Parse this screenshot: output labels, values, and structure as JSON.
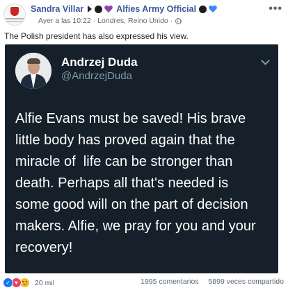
{
  "post": {
    "author": "Sandra Villar",
    "group": "Alfies Army Official",
    "timestamp": "Ayer a las 10:22",
    "location": "Londres, Reino Unido",
    "separator": "·",
    "text": "The Polish president has also expressed his view.",
    "more_menu": "•••"
  },
  "tweet": {
    "display_name": "Andrzej Duda",
    "handle": "@AndrzejDuda",
    "lines": [
      "Alfie Evans must be saved! His brave",
      "little body has proved again that the",
      "miracle of  life can be stronger than",
      "death. Perhaps all that's needed is",
      "some good will on the part of decision",
      "makers. Alfie, we pray for you and your",
      "recovery!"
    ]
  },
  "footer": {
    "reactions_count": "20 mil",
    "reaction_icons": [
      "like-icon",
      "love-icon",
      "sad-icon"
    ],
    "comments": "1995 comentarios",
    "shares": "5899 veces compartido"
  },
  "colors": {
    "link_blue": "#385898",
    "tweet_bg": "#15202b",
    "tweet_secondary": "#8899a6",
    "heart_purple": "#8e44ad",
    "heart_blue": "#3b88f5",
    "emoji_black": "#1d1d1d"
  }
}
